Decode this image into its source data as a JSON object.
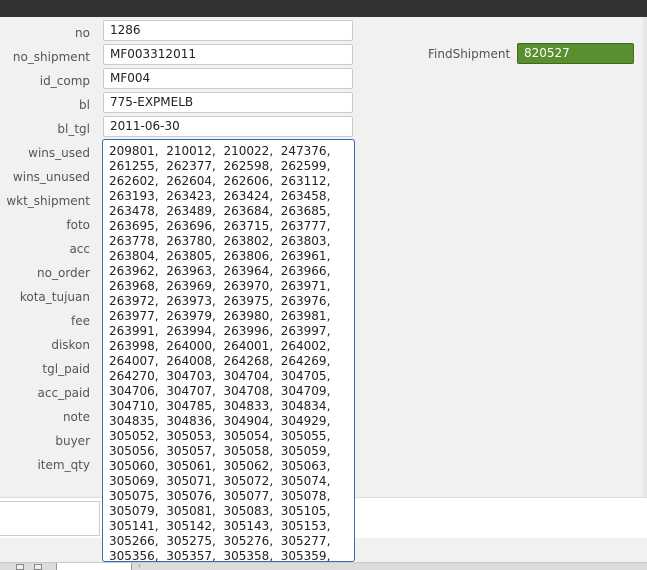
{
  "form": {
    "labels": {
      "no": "no",
      "no_shipment": "no_shipment",
      "id_comp": "id_comp",
      "bl": "bl",
      "bl_tgl": "bl_tgl",
      "wins_used": "wins_used",
      "wins_unused": "wins_unused",
      "wkt_shipment": "wkt_shipment",
      "foto": "foto",
      "acc": "acc",
      "no_order": "no_order",
      "kota_tujuan": "kota_tujuan",
      "fee": "fee",
      "diskon": "diskon",
      "tgl_paid": "tgl_paid",
      "acc_paid": "acc_paid",
      "note": "note",
      "buyer": "buyer",
      "item_qty": "item_qty"
    },
    "values": {
      "no": "1286",
      "no_shipment": "MF003312011",
      "id_comp": "MF004",
      "bl": "775-EXPMELB",
      "bl_tgl": "2011-06-30",
      "wins_used": "209801,  210012,  210022,  247376,\n261255,  262377,  262598,  262599,\n262602,  262604,  262606,  263112,\n263193,  263423,  263424,  263458,\n263478,  263489,  263684,  263685,\n263695,  263696,  263715,  263777,\n263778,  263780,  263802,  263803,\n263804,  263805,  263806,  263961,\n263962,  263963,  263964,  263966,\n263968,  263969,  263970,  263971,\n263972,  263973,  263975,  263976,\n263977,  263979,  263980,  263981,\n263991,  263994,  263996,  263997,\n263998,  264000,  264001,  264002,\n264007,  264008,  264268,  264269,\n264270,  304703,  304704,  304705,\n304706,  304707,  304708,  304709,\n304710,  304785,  304833,  304834,\n304835,  304836,  304904,  304929,\n305052,  305053,  305054,  305055,\n305056,  305057,  305058,  305059,\n305060,  305061,  305062,  305063,\n305069,  305071,  305072,  305074,\n305075,  305076,  305077,  305078,\n305079,  305081,  305083,  305105,\n305141,  305142,  305143,  305153,\n305266,  305275,  305276,  305277,\n305356,  305357,  305358,  305359,"
    }
  },
  "find_shipment": {
    "label": "FindShipment",
    "value": "820527",
    "color": "#5a8f2f"
  }
}
